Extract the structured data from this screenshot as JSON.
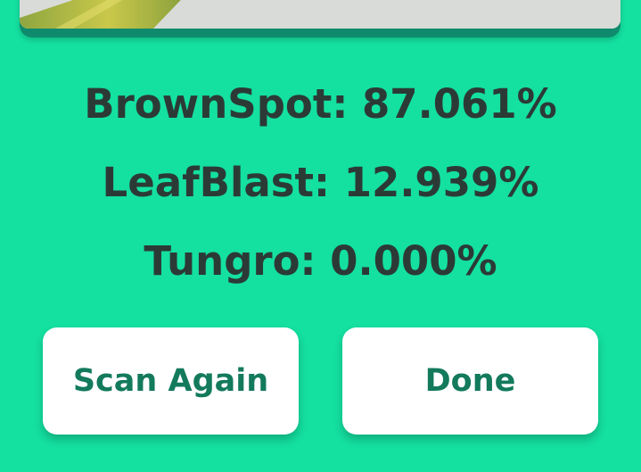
{
  "results": [
    {
      "label": "BrownSpot: 87.061%"
    },
    {
      "label": "LeafBlast: 12.939%"
    },
    {
      "label": "Tungro: 0.000%"
    }
  ],
  "buttons": {
    "scan_again": "Scan Again",
    "done": "Done"
  },
  "colors": {
    "background": "#14e0a0",
    "text": "#2c3a36",
    "button_text": "#137a5c",
    "button_bg": "#ffffff"
  }
}
